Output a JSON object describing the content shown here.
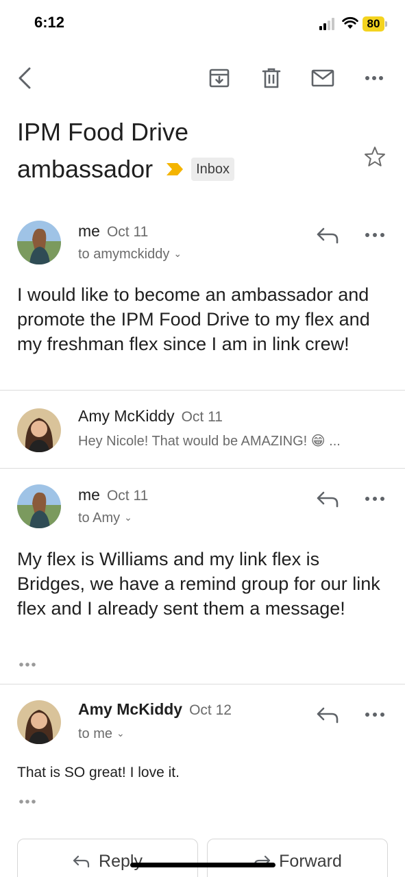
{
  "status_bar": {
    "time": "6:12",
    "battery": "80"
  },
  "toolbar": {
    "back_icon": "back-chevron-icon",
    "archive_icon": "archive-icon",
    "delete_icon": "trash-icon",
    "mark_unread_icon": "mail-icon",
    "more_icon": "more-horizontal-icon"
  },
  "subject": {
    "line1": "IPM Food Drive",
    "line2": "ambassador",
    "label": "Inbox"
  },
  "messages": [
    {
      "sender": "me",
      "date": "Oct 11",
      "recipient": "to amymckiddy",
      "body": "I would like to become an ambassador and promote the IPM Food Drive to my flex and my freshman flex since I am in link crew!"
    },
    {
      "sender": "Amy McKiddy",
      "date": "Oct 11",
      "snippet": "Hey Nicole! That would be AMAZING! 😁 ..."
    },
    {
      "sender": "me",
      "date": "Oct 11",
      "recipient": "to Amy",
      "body": "My flex is Williams and my link flex is Bridges, we have a remind group for our link flex and I already sent them a message!"
    },
    {
      "sender": "Amy McKiddy",
      "date": "Oct 12",
      "recipient": "to me",
      "body": "That is SO great! I love it."
    }
  ],
  "actions": {
    "reply": "Reply",
    "forward": "Forward"
  },
  "colors": {
    "importance": "#f4b400",
    "battery": "#f4d31f",
    "icon_gray": "#5f6368"
  }
}
